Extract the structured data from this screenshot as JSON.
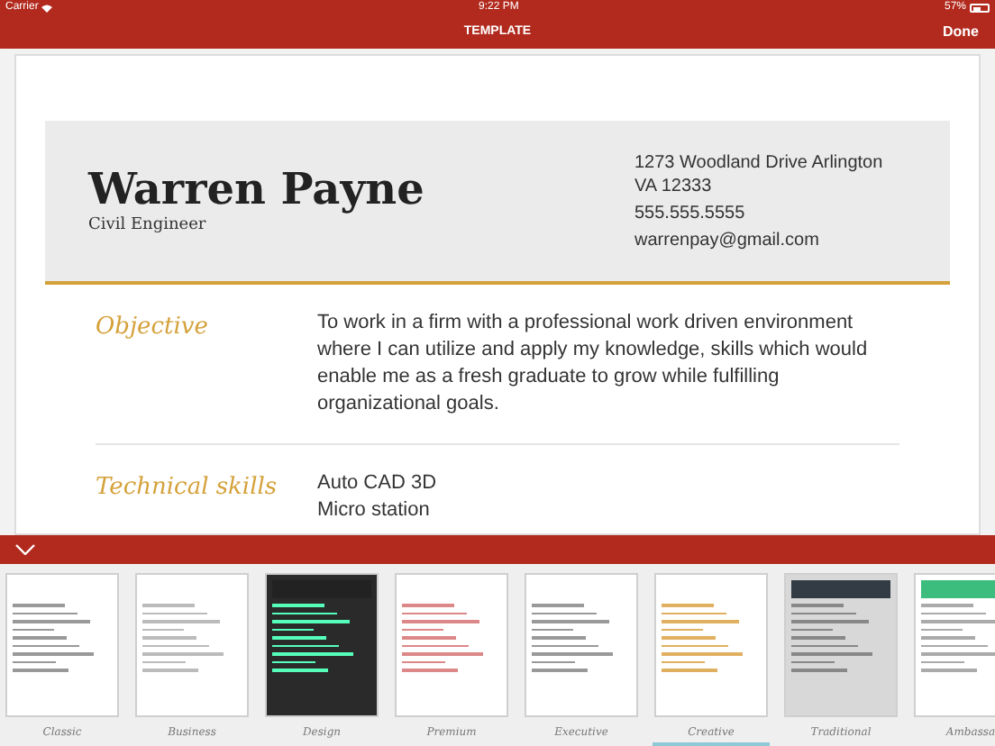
{
  "status_bar": {
    "carrier": "Carrier",
    "time": "9:22 PM",
    "battery": "57%"
  },
  "nav": {
    "title": "TEMPLATE",
    "done": "Done"
  },
  "resume": {
    "name": "Warren Payne",
    "role": "Civil Engineer",
    "address": "1273 Woodland Drive Arlington VA 12333",
    "phone": "555.555.5555",
    "email": "warrenpay@gmail.com",
    "sections": [
      {
        "heading": "Objective",
        "lines": [
          "To work in a firm with a professional work driven environment where I can utilize and apply my knowledge, skills which would enable me as a fresh graduate to grow while fulfilling organizational goals."
        ]
      },
      {
        "heading": "Technical skills",
        "lines": [
          "Auto CAD 3D",
          "Micro station"
        ]
      }
    ]
  },
  "templates": [
    {
      "label": "Classic",
      "kind": "classic",
      "selected": false
    },
    {
      "label": "Business",
      "kind": "business",
      "selected": false
    },
    {
      "label": "Design",
      "kind": "dark",
      "selected": false
    },
    {
      "label": "Premium",
      "kind": "premium",
      "selected": false
    },
    {
      "label": "Executive",
      "kind": "classic",
      "selected": false
    },
    {
      "label": "Creative",
      "kind": "creative",
      "selected": true
    },
    {
      "label": "Traditional",
      "kind": "traditional",
      "selected": false
    },
    {
      "label": "Ambassa",
      "kind": "green",
      "selected": false
    }
  ]
}
